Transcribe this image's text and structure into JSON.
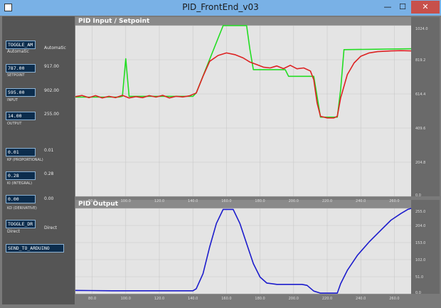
{
  "window": {
    "title": "PID_FrontEnd_v03",
    "minimize": "—",
    "maximize": "☐",
    "close": "✕"
  },
  "controls": {
    "toggle_am": {
      "field": "TOGGLE_AM",
      "caption": "Automatic",
      "value": "Automatic"
    },
    "setpoint": {
      "field": "787.00",
      "caption": "SETPOINT",
      "value": "917.00"
    },
    "input": {
      "field": "595.00",
      "caption": "INPUT",
      "value": "902.00"
    },
    "output": {
      "field": "14.00",
      "caption": "OUTPUT",
      "value": "255.00"
    },
    "kp": {
      "field": "0.01",
      "caption": "KP (PROPORTIONAL)",
      "value": "0.01"
    },
    "ki": {
      "field": "0.28",
      "caption": "KI (INTEGRAL)",
      "value": "0.28"
    },
    "kd": {
      "field": "0.00",
      "caption": "KD (DERIVATIVE)",
      "value": "0.00"
    },
    "toggle_dr": {
      "field": "TOGGLE_DR",
      "caption": "Direct",
      "value": "Direct"
    },
    "send_button": "SEND_TO_ARDUINO"
  },
  "charts": {
    "input_setpoint": {
      "title": "PID Input / Setpoint",
      "y_ticks": [
        "1024.0",
        "819.2",
        "614.4",
        "409.6",
        "204.8",
        "0.0"
      ],
      "x_ticks": [
        "80.0",
        "100.0",
        "120.0",
        "140.0",
        "160.0",
        "180.0",
        "200.0",
        "220.0",
        "240.0",
        "260.0"
      ]
    },
    "output": {
      "title": "PID Output",
      "y_ticks": [
        "255.0",
        "204.0",
        "153.0",
        "102.0",
        "51.0",
        "0.0"
      ],
      "x_ticks": [
        "80.0",
        "100.0",
        "120.0",
        "140.0",
        "160.0",
        "180.0",
        "200.0",
        "220.0",
        "240.0",
        "260.0"
      ]
    }
  },
  "chart_data": [
    {
      "type": "line",
      "title": "PID Input / Setpoint",
      "ylim": [
        0,
        1024
      ],
      "xlim": [
        70,
        270
      ],
      "grid": true,
      "series": [
        {
          "color": "#22dd22",
          "points": [
            [
              70,
              595
            ],
            [
              96,
              595
            ],
            [
              98,
              600
            ],
            [
              100,
              825
            ],
            [
              102,
              600
            ],
            [
              104,
              600
            ],
            [
              140,
              600
            ],
            [
              142,
              620
            ],
            [
              158,
              1024
            ],
            [
              172,
              1024
            ],
            [
              174,
              880
            ],
            [
              176,
              760
            ],
            [
              195,
              760
            ],
            [
              197,
              720
            ],
            [
              212,
              720
            ],
            [
              214,
              600
            ],
            [
              216,
              475
            ],
            [
              218,
              475
            ],
            [
              226,
              475
            ],
            [
              228,
              640
            ],
            [
              230,
              880
            ],
            [
              270,
              885
            ]
          ]
        },
        {
          "color": "#dd2222",
          "points": [
            [
              70,
              598
            ],
            [
              74,
              605
            ],
            [
              78,
              592
            ],
            [
              82,
              604
            ],
            [
              86,
              590
            ],
            [
              90,
              600
            ],
            [
              94,
              592
            ],
            [
              98,
              606
            ],
            [
              102,
              590
            ],
            [
              106,
              598
            ],
            [
              110,
              592
            ],
            [
              114,
              604
            ],
            [
              118,
              595
            ],
            [
              122,
              606
            ],
            [
              126,
              590
            ],
            [
              130,
              600
            ],
            [
              134,
              596
            ],
            [
              138,
              603
            ],
            [
              142,
              620
            ],
            [
              146,
              720
            ],
            [
              150,
              810
            ],
            [
              155,
              845
            ],
            [
              160,
              860
            ],
            [
              165,
              850
            ],
            [
              170,
              830
            ],
            [
              174,
              805
            ],
            [
              178,
              790
            ],
            [
              182,
              775
            ],
            [
              186,
              770
            ],
            [
              190,
              782
            ],
            [
              194,
              766
            ],
            [
              198,
              786
            ],
            [
              202,
              765
            ],
            [
              206,
              770
            ],
            [
              210,
              752
            ],
            [
              212,
              700
            ],
            [
              214,
              560
            ],
            [
              216,
              480
            ],
            [
              220,
              470
            ],
            [
              224,
              470
            ],
            [
              226,
              480
            ],
            [
              228,
              590
            ],
            [
              232,
              730
            ],
            [
              236,
              800
            ],
            [
              240,
              840
            ],
            [
              245,
              860
            ],
            [
              250,
              868
            ],
            [
              258,
              872
            ],
            [
              264,
              874
            ],
            [
              270,
              872
            ]
          ]
        }
      ]
    },
    {
      "type": "line",
      "title": "PID Output",
      "ylim": [
        0,
        255
      ],
      "xlim": [
        70,
        270
      ],
      "grid": true,
      "series": [
        {
          "color": "#1c1ccc",
          "points": [
            [
              70,
              10
            ],
            [
              92,
              9
            ],
            [
              110,
              9
            ],
            [
              140,
              9
            ],
            [
              142,
              15
            ],
            [
              146,
              60
            ],
            [
              150,
              140
            ],
            [
              154,
              210
            ],
            [
              158,
              252
            ],
            [
              164,
              252
            ],
            [
              168,
              210
            ],
            [
              172,
              150
            ],
            [
              176,
              90
            ],
            [
              180,
              50
            ],
            [
              184,
              32
            ],
            [
              190,
              28
            ],
            [
              205,
              28
            ],
            [
              208,
              25
            ],
            [
              212,
              8
            ],
            [
              216,
              2
            ],
            [
              226,
              2
            ],
            [
              228,
              30
            ],
            [
              232,
              70
            ],
            [
              238,
              115
            ],
            [
              245,
              155
            ],
            [
              252,
              190
            ],
            [
              258,
              220
            ],
            [
              264,
              240
            ],
            [
              268,
              252
            ],
            [
              270,
              255
            ]
          ]
        }
      ]
    }
  ]
}
